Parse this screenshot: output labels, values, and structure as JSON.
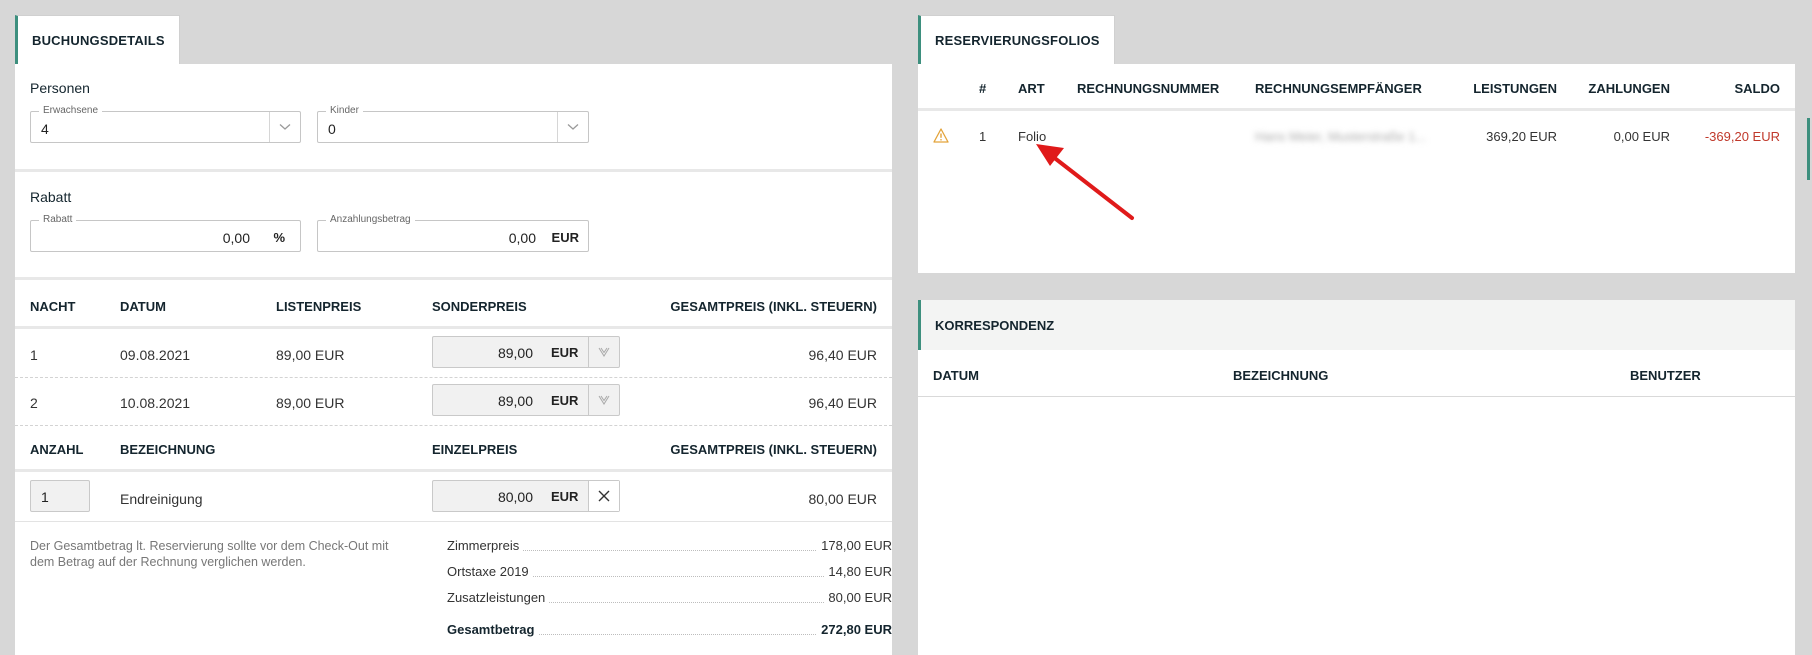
{
  "booking": {
    "tab": "BUCHUNGSDETAILS",
    "persons_title": "Personen",
    "adults_legend": "Erwachsene",
    "adults_value": "4",
    "children_legend": "Kinder",
    "children_value": "0",
    "discount_title": "Rabatt",
    "discount_legend": "Rabatt",
    "discount_value": "0,00",
    "discount_unit": "%",
    "deposit_legend": "Anzahlungsbetrag",
    "deposit_value": "0,00",
    "deposit_unit": "EUR",
    "nights_headers": [
      "NACHT",
      "DATUM",
      "LISTENPREIS",
      "SONDERPREIS",
      "GESAMTPREIS (INKL. STEUERN)"
    ],
    "nights": [
      {
        "night": "1",
        "date": "09.08.2021",
        "list": "89,00 EUR",
        "special": "89,00",
        "unit": "EUR",
        "total": "96,40 EUR"
      },
      {
        "night": "2",
        "date": "10.08.2021",
        "list": "89,00 EUR",
        "special": "89,00",
        "unit": "EUR",
        "total": "96,40 EUR"
      }
    ],
    "extras_headers": [
      "ANZAHL",
      "BEZEICHNUNG",
      "EINZELPREIS",
      "GESAMTPREIS (INKL. STEUERN)"
    ],
    "extras": [
      {
        "qty": "1",
        "name": "Endreinigung",
        "price": "80,00",
        "unit": "EUR",
        "total": "80,00 EUR"
      }
    ],
    "note": "Der Gesamtbetrag lt. Reservierung sollte vor dem Check-Out mit dem Betrag auf der Rechnung verglichen werden.",
    "summary": [
      {
        "label": "Zimmerpreis",
        "value": "178,00 EUR"
      },
      {
        "label": "Ortstaxe 2019",
        "value": "14,80 EUR"
      },
      {
        "label": "Zusatzleistungen",
        "value": "80,00 EUR"
      }
    ],
    "total_label": "Gesamtbetrag",
    "total_value": "272,80 EUR"
  },
  "folios": {
    "tab": "RESERVIERUNGSFOLIOS",
    "headers": [
      "#",
      "ART",
      "RECHNUNGSNUMMER",
      "RECHNUNGSEMPFÄNGER",
      "LEISTUNGEN",
      "ZAHLUNGEN",
      "SALDO"
    ],
    "rows": [
      {
        "num": "1",
        "type": "Folio",
        "invoice": "",
        "recipient": "Hans Meier, Musterstraße 1...",
        "services": "369,20 EUR",
        "payments": "0,00 EUR",
        "balance": "-369,20 EUR"
      }
    ]
  },
  "correspondence": {
    "title": "KORRESPONDENZ",
    "headers": [
      "DATUM",
      "BEZEICHNUNG",
      "BENUTZER"
    ]
  },
  "colors": {
    "accent": "#3d8f7e",
    "negative": "#c0392b",
    "warning": "#e3a33a",
    "arrow": "#e01a1a"
  }
}
